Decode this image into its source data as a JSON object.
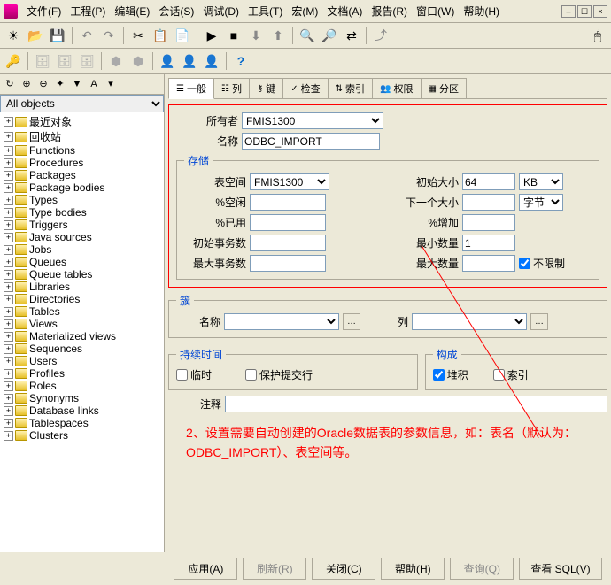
{
  "menu": {
    "file": "文件(F)",
    "project": "工程(P)",
    "edit": "编辑(E)",
    "session": "会话(S)",
    "debug": "调试(D)",
    "tools": "工具(T)",
    "macro": "宏(M)",
    "doc": "文档(A)",
    "report": "报告(R)",
    "window": "窗口(W)",
    "help": "帮助(H)"
  },
  "tree": {
    "filter": "All objects",
    "items": [
      "最近对象",
      "回收站",
      "Functions",
      "Procedures",
      "Packages",
      "Package bodies",
      "Types",
      "Type bodies",
      "Triggers",
      "Java sources",
      "Jobs",
      "Queues",
      "Queue tables",
      "Libraries",
      "Directories",
      "Tables",
      "Views",
      "Materialized views",
      "Sequences",
      "Users",
      "Profiles",
      "Roles",
      "Synonyms",
      "Database links",
      "Tablespaces",
      "Clusters"
    ]
  },
  "tabs": [
    {
      "label": "一般",
      "icon": "☰"
    },
    {
      "label": "列",
      "icon": "☷"
    },
    {
      "label": "键",
      "icon": "⚷"
    },
    {
      "label": "检查",
      "icon": "✓"
    },
    {
      "label": "索引",
      "icon": "⇅"
    },
    {
      "label": "权限",
      "icon": "👥"
    },
    {
      "label": "分区",
      "icon": "▦"
    }
  ],
  "form": {
    "owner_label": "所有者",
    "owner_value": "FMIS1300",
    "name_label": "名称",
    "name_value": "ODBC_IMPORT",
    "storage_legend": "存储",
    "tablespace_label": "表空间",
    "tablespace_value": "FMIS1300",
    "pctfree_label": "%空闲",
    "pctused_label": "%已用",
    "initrans_label": "初始事务数",
    "maxtrans_label": "最大事务数",
    "initial_label": "初始大小",
    "initial_value": "64",
    "initial_unit": "KB",
    "next_label": "下一个大小",
    "next_unit": "字节",
    "pctinc_label": "%增加",
    "minext_label": "最小数量",
    "minext_value": "1",
    "maxext_label": "最大数量",
    "unlimited_label": "不限制",
    "cluster_legend": "簇",
    "cluster_name_label": "名称",
    "column_label": "列",
    "duration_legend": "持续时间",
    "temp_label": "临时",
    "preserve_label": "保护提交行",
    "org_legend": "构成",
    "heap_label": "堆积",
    "index_label": "索引",
    "comment_label": "注释"
  },
  "buttons": {
    "apply": "应用(A)",
    "refresh": "刷新(R)",
    "close": "关闭(C)",
    "help": "帮助(H)",
    "query": "查询(Q)",
    "viewsql": "查看 SQL(V)"
  },
  "annotation": "2、设置需要自动创建的Oracle数据表的参数信息，如：表名（默认为：ODBC_IMPORT）、表空间等。"
}
